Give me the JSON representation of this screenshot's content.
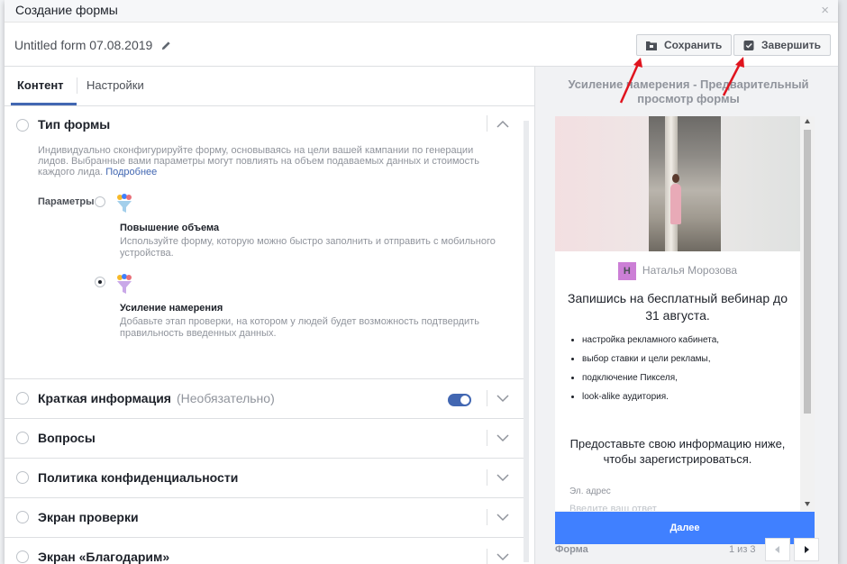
{
  "dialog": {
    "title": "Создание формы",
    "close": "×"
  },
  "header": {
    "form_name": "Untitled form 07.08.2019",
    "save_label": "Сохранить",
    "finish_label": "Завершить"
  },
  "tabs": [
    {
      "label": "Контент"
    },
    {
      "label": "Настройки"
    }
  ],
  "form_type": {
    "title": "Тип формы",
    "description": "Индивидуально сконфигурируйте форму, основываясь на цели вашей кампании по генерации лидов. Выбранные вами параметры могут повлиять на объем подаваемых данных и стоимость каждого лида.",
    "more_link": "Подробнее",
    "params_label": "Параметры",
    "options": [
      {
        "title": "Повышение объема",
        "desc": "Используйте форму, которую можно быстро заполнить и отправить с мобильного устройства.",
        "selected": false
      },
      {
        "title": "Усиление намерения",
        "desc": "Добавьте этап проверки, на котором у людей будет возможность подтвердить правильность введенных данных.",
        "selected": true
      }
    ]
  },
  "sections": [
    {
      "title": "Краткая информация",
      "optional": "(Необязательно)",
      "toggle": true
    },
    {
      "title": "Вопросы"
    },
    {
      "title": "Политика конфиденциальности"
    },
    {
      "title": "Экран проверки"
    },
    {
      "title": "Экран «Благодарим»"
    }
  ],
  "preview": {
    "title": "Усиление намерения - Предварительный просмотр формы",
    "avatar_letter": "Н",
    "page_name": "Наталья Морозова",
    "headline": "Запишись на бесплатный вебинар до 31 августа.",
    "bullets": [
      "настройка рекламного кабинета,",
      "выбор ставки и цели рекламы,",
      "подключение Пикселя,",
      "look-alike аудитория."
    ],
    "info_text": "Предоставьте свою информацию ниже, чтобы зарегистрироваться.",
    "field_label": "Эл. адрес",
    "field_placeholder": "Введите ваш ответ",
    "next_button": "Далее",
    "footer_label": "Форма",
    "pager": "1 из 3"
  },
  "colors": {
    "accent": "#4267b2",
    "next_button": "#4080ff",
    "annotation_arrow": "#e0141e"
  }
}
